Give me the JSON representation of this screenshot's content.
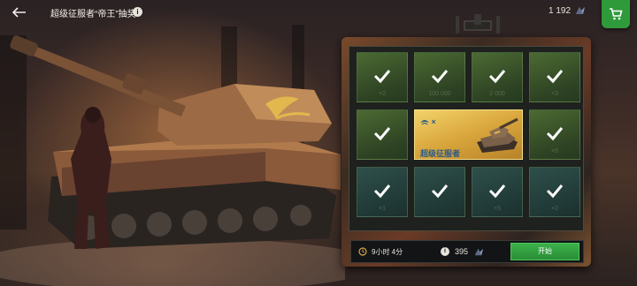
{
  "header": {
    "title": "超级征服者“帝王”抽奖",
    "currency_amount": "1 192",
    "icons": {
      "back": "arrow-left-icon",
      "info": "info-icon",
      "currency": "gold-icon",
      "shop": "cart-icon"
    }
  },
  "grid": {
    "cells": [
      {
        "row": 1,
        "col": 1,
        "style": "green",
        "ghost": "×2",
        "checked": true
      },
      {
        "row": 1,
        "col": 2,
        "style": "green",
        "ghost": "100 000",
        "checked": true
      },
      {
        "row": 1,
        "col": 3,
        "style": "green",
        "ghost": "2 000",
        "checked": true
      },
      {
        "row": 1,
        "col": 4,
        "style": "green",
        "ghost": "×3",
        "checked": true
      },
      {
        "row": 2,
        "col": 1,
        "style": "green",
        "ghost": "",
        "checked": true
      },
      {
        "row": 2,
        "col": 4,
        "style": "green",
        "ghost": "×5",
        "checked": true
      },
      {
        "row": 3,
        "col": 1,
        "style": "teal",
        "ghost": "×1",
        "checked": true
      },
      {
        "row": 3,
        "col": 2,
        "style": "teal",
        "ghost": "",
        "checked": true
      },
      {
        "row": 3,
        "col": 3,
        "style": "teal",
        "ghost": "×5",
        "checked": true
      },
      {
        "row": 3,
        "col": 4,
        "style": "teal",
        "ghost": "×2",
        "checked": true
      }
    ],
    "featured": {
      "prefix": "×",
      "name": "超级征服者"
    }
  },
  "footer": {
    "timer": "9小时 4分",
    "cost": "395",
    "start_label": "开始"
  },
  "colors": {
    "accent_green": "#2f9a3a",
    "featured_gold": "#d9a63c",
    "text_blue": "#2a5b8a"
  }
}
